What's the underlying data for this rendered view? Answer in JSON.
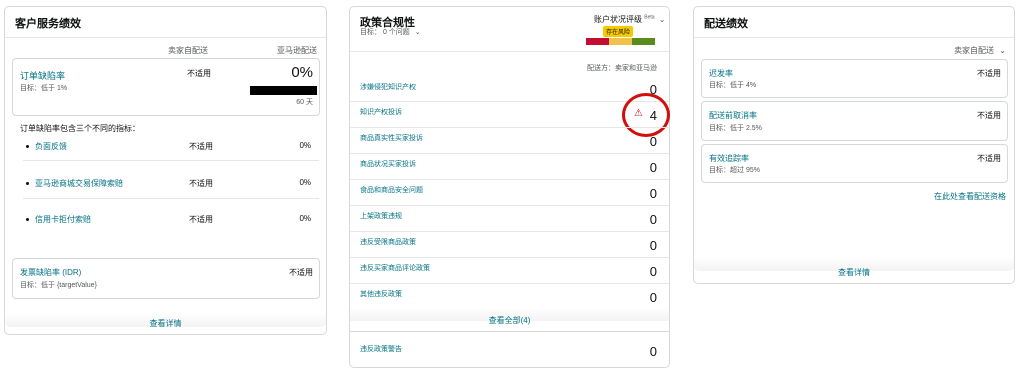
{
  "customer_service": {
    "title": "客户服务绩效",
    "col_merchant": "卖家自配送",
    "col_amazon": "亚马逊配送",
    "odr": {
      "label": "订单缺陷率",
      "target": "目标：低于 1%",
      "merchant_value": "不适用",
      "amazon_value": "0%",
      "days": "60 天"
    },
    "odr_intro": "订单缺陷率包含三个不同的指标：",
    "metrics": [
      {
        "label": "负面反馈",
        "merchant": "不适用",
        "amazon": "0%"
      },
      {
        "label": "亚马逊商城交易保障索赔",
        "merchant": "不适用",
        "amazon": "0%"
      },
      {
        "label": "信用卡拒付索赔",
        "merchant": "不适用",
        "amazon": "0%"
      }
    ],
    "idr": {
      "label": "发票缺陷率 (IDR)",
      "target": "目标：低于 {targetValue}",
      "value": "不适用"
    },
    "view_details": "查看详情"
  },
  "policy": {
    "title": "政策合规性",
    "target": "目标： 0 个问题",
    "rating_label": "账户状况评级",
    "beta": "Beta",
    "risk_badge": "存在风险",
    "fulfilled_by": "配送方：卖家和亚马逊",
    "colors": {
      "red": "#c40d33",
      "yellow": "#f0c14b",
      "green": "#5a8b1d",
      "badge": "#f7ca00",
      "circle": "#d10f0f"
    },
    "items": [
      {
        "label": "涉嫌侵犯知识产权",
        "count": "0"
      },
      {
        "label": "知识产权投诉",
        "count": "4"
      },
      {
        "label": "商品真实性买家投诉",
        "count": "0"
      },
      {
        "label": "商品状况买家投诉",
        "count": "0"
      },
      {
        "label": "食品和商品安全问题",
        "count": "0"
      },
      {
        "label": "上架政策违规",
        "count": "0"
      },
      {
        "label": "违反受限商品政策",
        "count": "0"
      },
      {
        "label": "违反买家商品评论政策",
        "count": "0"
      },
      {
        "label": "其他违反政策",
        "count": "0"
      }
    ],
    "view_all": "查看全部(4)",
    "warning": {
      "label": "违反政策警告",
      "count": "0"
    }
  },
  "shipping": {
    "title": "配送绩效",
    "selector": "卖家自配送",
    "metrics": [
      {
        "label": "迟发率",
        "target": "目标：低于 4%",
        "value": "不适用"
      },
      {
        "label": "配送前取消率",
        "target": "目标：低于 2.5%",
        "value": "不适用"
      },
      {
        "label": "有效追踪率",
        "target": "目标：超过 95%",
        "value": "不适用"
      }
    ],
    "eligibility_link": "在此处查看配送资格",
    "view_details": "查看详情"
  }
}
